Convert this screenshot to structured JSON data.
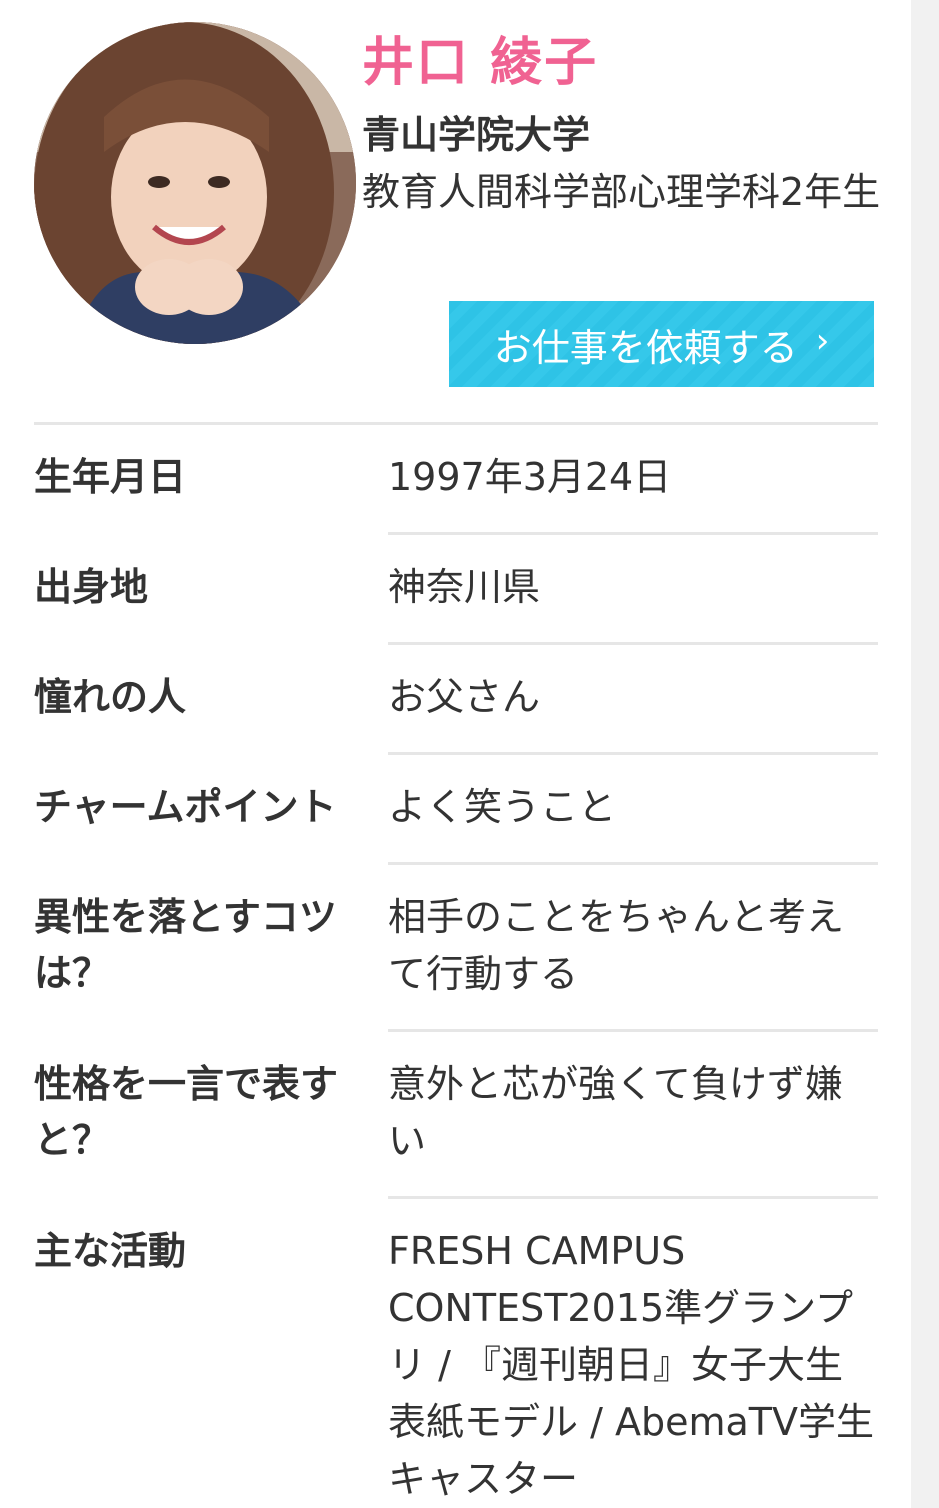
{
  "profile": {
    "name": "井口 綾子",
    "university": "青山学院大学",
    "department": "教育人間科学部心理学科2年生",
    "request_button": "お仕事を依頼する",
    "request_chevron": "›"
  },
  "details": [
    {
      "label": "生年月日",
      "value": "1997年3月24日"
    },
    {
      "label": "出身地",
      "value": "神奈川県"
    },
    {
      "label": "憧れの人",
      "value": "お父さん"
    },
    {
      "label": "チャームポイント",
      "value": "よく笑うこと"
    },
    {
      "label": "異性を落とすコツは？",
      "value": "相手のことをちゃんと考えて行動する"
    },
    {
      "label": "性格を一言で表すと？",
      "value": "意外と芯が強くて負けず嫌い"
    },
    {
      "label": "主な活動",
      "value": "FRESH CAMPUS CONTEST2015準グランプリ / 『週刊朝日』女子大生表紙モデル / AbemaTV学生キャスター"
    }
  ],
  "colors": {
    "name": "#f06292",
    "button": "#2ec3e6",
    "divider": "#e6e6e6"
  }
}
